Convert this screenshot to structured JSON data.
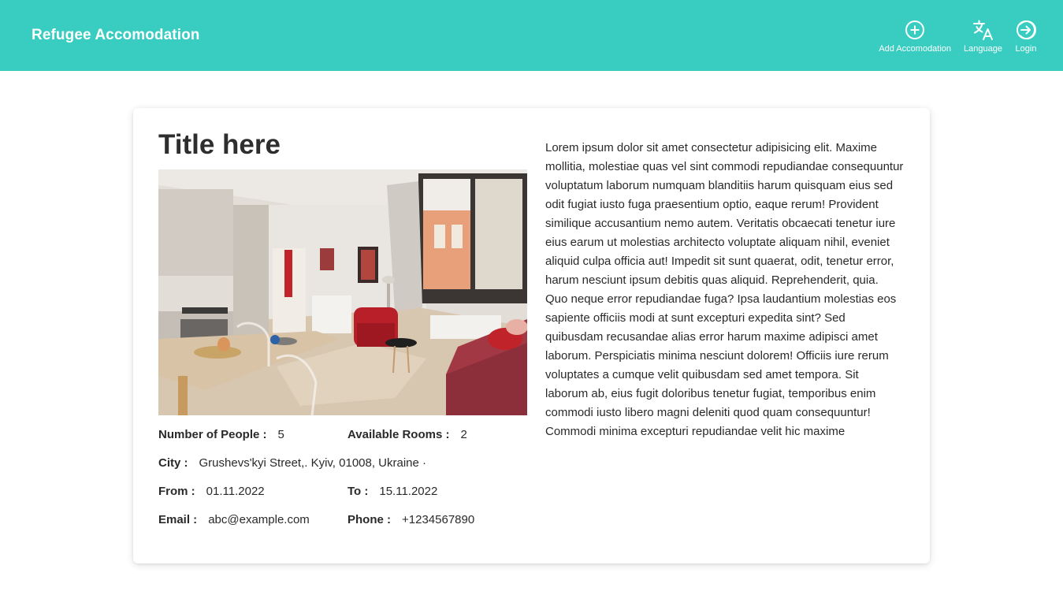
{
  "header": {
    "brand": "Refugee Accomodation",
    "nav": {
      "add": {
        "label": "Add Accomodation",
        "icon": "plus-circle-icon"
      },
      "language": {
        "label": "Language",
        "icon": "translate-icon"
      },
      "login": {
        "label": "Login",
        "icon": "login-icon"
      }
    }
  },
  "listing": {
    "title": "Title here",
    "photo_icon": "apartment-photo",
    "details": {
      "people_label": "Number of People :",
      "people_value": "5",
      "rooms_label": "Available Rooms :",
      "rooms_value": "2",
      "city_label": "City :",
      "city_value": "Grushevs'kyi Street,. Kyiv, 01008, Ukraine ·",
      "from_label": "From :",
      "from_value": "01.11.2022",
      "to_label": "To :",
      "to_value": "15.11.2022",
      "email_label": "Email :",
      "email_value": "abc@example.com",
      "phone_label": "Phone :",
      "phone_value": "+1234567890"
    },
    "description": "Lorem ipsum dolor sit amet consectetur adipisicing elit. Maxime mollitia, molestiae quas vel sint commodi repudiandae consequuntur voluptatum laborum numquam blanditiis harum quisquam eius sed odit fugiat iusto fuga praesentium optio, eaque rerum! Provident similique accusantium nemo autem. Veritatis obcaecati tenetur iure eius earum ut molestias architecto voluptate aliquam nihil, eveniet aliquid culpa officia aut! Impedit sit sunt quaerat, odit, tenetur error, harum nesciunt ipsum debitis quas aliquid. Reprehenderit, quia. Quo neque error repudiandae fuga? Ipsa laudantium molestias eos sapiente officiis modi at sunt excepturi expedita sint? Sed quibusdam recusandae alias error harum maxime adipisci amet laborum. Perspiciatis minima nesciunt dolorem! Officiis iure rerum voluptates a cumque velit quibusdam sed amet tempora. Sit laborum ab, eius fugit doloribus tenetur fugiat, temporibus enim commodi iusto libero magni deleniti quod quam consequuntur! Commodi minima excepturi repudiandae velit hic maxime"
  },
  "colors": {
    "appbar": "#38cdc0",
    "text": "#212121"
  }
}
